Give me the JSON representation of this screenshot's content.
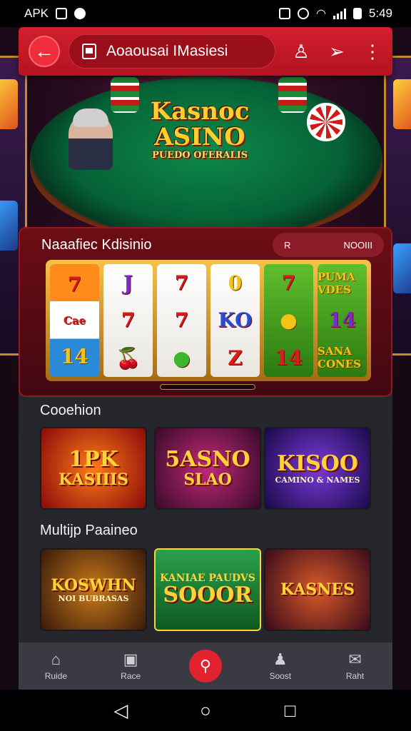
{
  "status_bar": {
    "left_text": "APK",
    "time": "5:49"
  },
  "header": {
    "back_icon": "back-arrow-icon",
    "title": "Aoaousai IMasiesi",
    "icons": [
      "person-icon",
      "send-icon",
      "more-vert-icon"
    ]
  },
  "hero": {
    "logo_line1": "Kasnoc",
    "logo_line2": "ASINO",
    "logo_tagline": "PUEDO OFERALIS"
  },
  "slot_section": {
    "title": "Naaafiec Kdisinio",
    "chip_left": "R",
    "chip_right": "NOOIII",
    "reels": [
      [
        "7",
        "Cae",
        "14"
      ],
      [
        "J",
        "7",
        "🍒"
      ],
      [
        "7",
        "7",
        "●"
      ],
      [
        "0",
        "KO",
        "Z"
      ],
      [
        "7",
        "●",
        "14"
      ],
      [
        "PUMA VDES",
        "14",
        "SANA CONES"
      ]
    ]
  },
  "collection": {
    "label": "Cooehion",
    "cards": [
      {
        "big": "1PK",
        "mid": "KASIIIS"
      },
      {
        "big": "5ASNO",
        "mid": "SLAO"
      },
      {
        "big": "KISOO",
        "mid": "CAMINO & NAMES"
      }
    ]
  },
  "multiplayer": {
    "label": "Multijp Paaineo",
    "cards": [
      {
        "big": "KOSWHN",
        "mid": "NOI BUBRASAS"
      },
      {
        "big": "SOOOR",
        "mid": "KANIAE PAUDVS"
      },
      {
        "big": "KASNES",
        "mid": ""
      }
    ]
  },
  "bottom_nav": {
    "items": [
      {
        "label": "Ruide",
        "icon": "home-icon"
      },
      {
        "label": "Race",
        "icon": "photo-icon"
      },
      {
        "label": "",
        "icon": "search-icon"
      },
      {
        "label": "Soost",
        "icon": "user-icon"
      },
      {
        "label": "Raht",
        "icon": "chat-icon"
      }
    ]
  },
  "system_nav": {
    "back": "◁",
    "home": "○",
    "recents": "□"
  },
  "colors": {
    "header_red": "#d11f2f",
    "panel_bg": "#26262d",
    "accent_gold": "#ffd23a"
  }
}
